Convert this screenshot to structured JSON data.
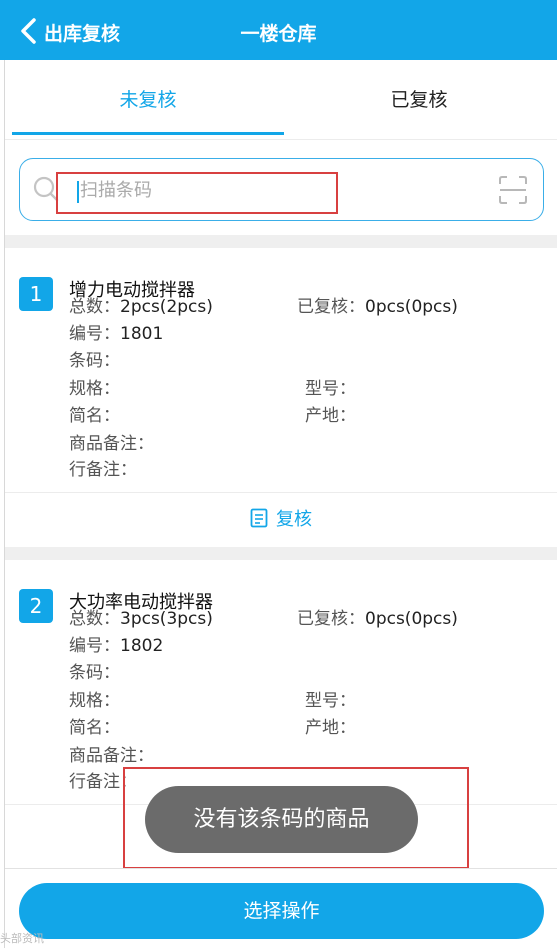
{
  "header": {
    "back_label": "出库复核",
    "title": "一楼仓库"
  },
  "tabs": [
    {
      "label": "未复核",
      "active": true
    },
    {
      "label": "已复核",
      "active": false
    }
  ],
  "search": {
    "placeholder": "扫描条码",
    "value": ""
  },
  "labels": {
    "total": "总数：",
    "reviewed": "已复核：",
    "code": "编号：",
    "barcode": "条码：",
    "spec": "规格：",
    "model": "型号：",
    "short_name": "简名：",
    "origin": "产地：",
    "product_note": "商品备注：",
    "line_note": "行备注："
  },
  "items": [
    {
      "index": "1",
      "name": "增力电动搅拌器",
      "total": "2pcs(2pcs)",
      "reviewed": "0pcs(0pcs)",
      "code": "1801",
      "barcode": "",
      "spec": "",
      "model": "",
      "short_name": "",
      "origin": "",
      "product_note": "",
      "line_note": "",
      "review_label": "复核"
    },
    {
      "index": "2",
      "name": "大功率电动搅拌器",
      "total": "3pcs(3pcs)",
      "reviewed": "0pcs(0pcs)",
      "code": "1802",
      "barcode": "",
      "spec": "",
      "model": "",
      "short_name": "",
      "origin": "",
      "product_note": "",
      "line_note": "",
      "review_label": "复核"
    }
  ],
  "toast": {
    "message": "没有该条码的商品"
  },
  "bottom": {
    "action_label": "选择操作"
  },
  "watermark": "头部资讯",
  "colors": {
    "primary": "#12a6e8",
    "highlight_box": "#d84040",
    "toast_bg": "#6b6b6b",
    "separator": "#efefef"
  },
  "icons": {
    "back": "chevron-left-icon",
    "search": "search-icon",
    "scan": "scan-icon",
    "review": "document-check-icon"
  }
}
